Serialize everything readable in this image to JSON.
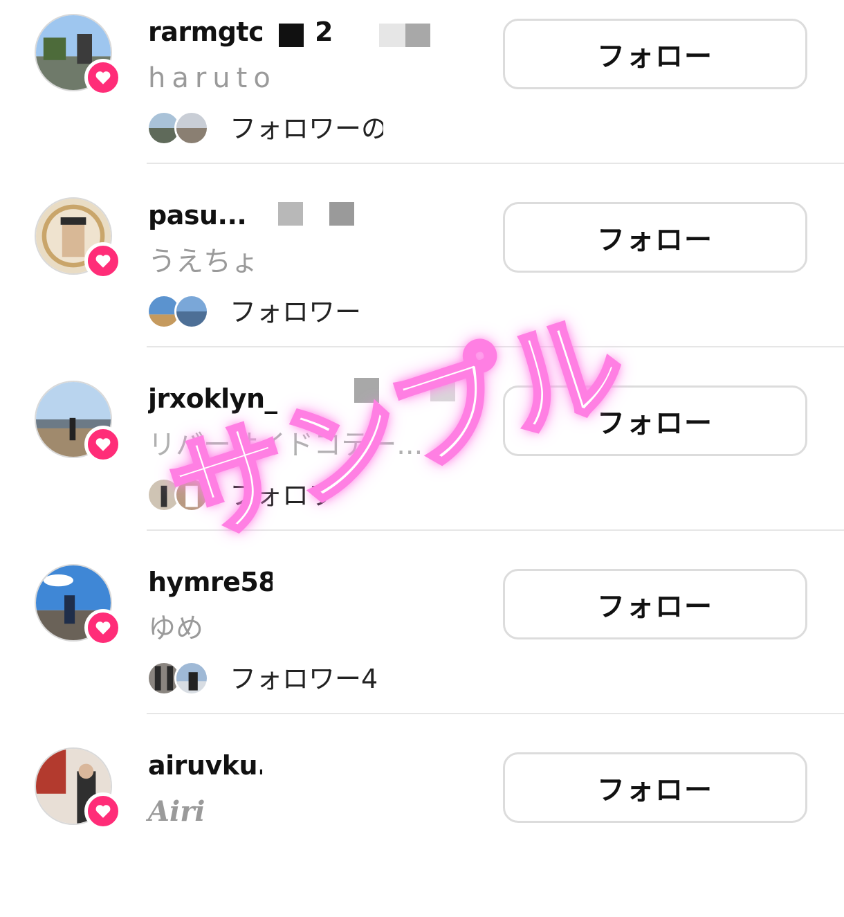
{
  "follow_button_label": "フォロー",
  "watermark": "サンプル",
  "colors": {
    "badge": "#ff2d78",
    "watermark_glow": "#ff7fe3",
    "button_border": "#dcdcdc"
  },
  "rows": [
    {
      "username": "rarmgtc",
      "username_extra": "2",
      "subname": "haruto",
      "followers_text": "フォロワーの",
      "badge_icon": "heart-icon"
    },
    {
      "username": "pasu...",
      "username_extra": "",
      "subname": "うえちょ",
      "followers_text": "フォロワー",
      "badge_icon": "heart-icon"
    },
    {
      "username": "jrxoklyn_",
      "username_extra": "",
      "subname": "リバーサイドコテー...",
      "followers_text": "フォロワ",
      "badge_icon": "heart-icon"
    },
    {
      "username": "hymre58",
      "username_extra": "",
      "subname": "ゆめ",
      "followers_text": "フォロワー4",
      "badge_icon": "heart-icon"
    },
    {
      "username": "airuvku.",
      "username_extra": "",
      "subname": "Airi",
      "followers_text": "",
      "badge_icon": "heart-icon"
    }
  ]
}
